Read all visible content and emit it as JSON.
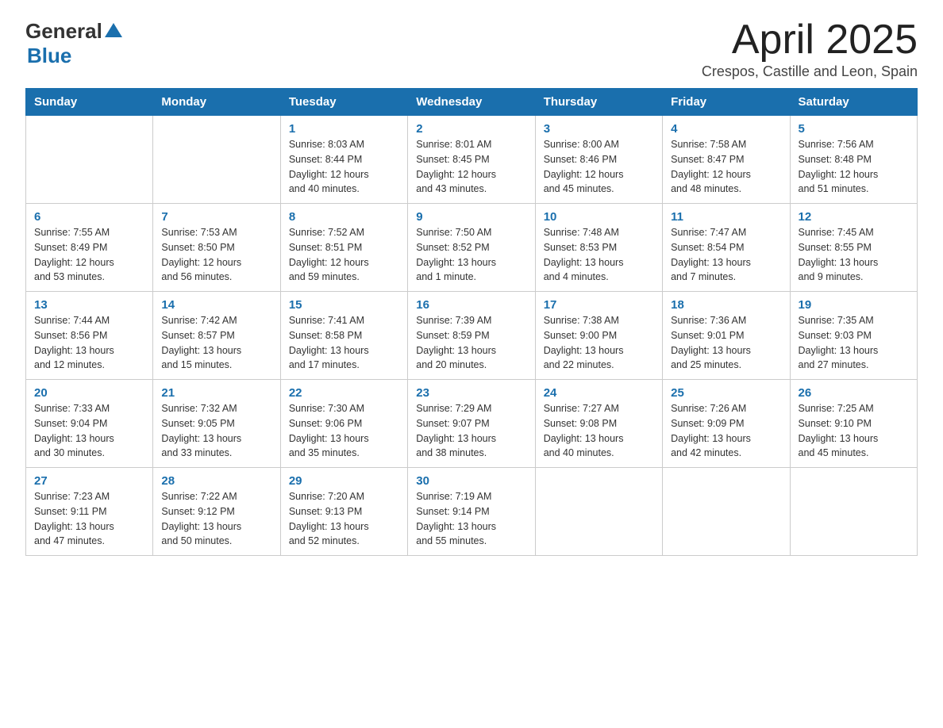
{
  "header": {
    "logo_general": "General",
    "logo_blue": "Blue",
    "title": "April 2025",
    "subtitle": "Crespos, Castille and Leon, Spain"
  },
  "calendar": {
    "days_of_week": [
      "Sunday",
      "Monday",
      "Tuesday",
      "Wednesday",
      "Thursday",
      "Friday",
      "Saturday"
    ],
    "weeks": [
      [
        {
          "day": "",
          "info": ""
        },
        {
          "day": "",
          "info": ""
        },
        {
          "day": "1",
          "info": "Sunrise: 8:03 AM\nSunset: 8:44 PM\nDaylight: 12 hours\nand 40 minutes."
        },
        {
          "day": "2",
          "info": "Sunrise: 8:01 AM\nSunset: 8:45 PM\nDaylight: 12 hours\nand 43 minutes."
        },
        {
          "day": "3",
          "info": "Sunrise: 8:00 AM\nSunset: 8:46 PM\nDaylight: 12 hours\nand 45 minutes."
        },
        {
          "day": "4",
          "info": "Sunrise: 7:58 AM\nSunset: 8:47 PM\nDaylight: 12 hours\nand 48 minutes."
        },
        {
          "day": "5",
          "info": "Sunrise: 7:56 AM\nSunset: 8:48 PM\nDaylight: 12 hours\nand 51 minutes."
        }
      ],
      [
        {
          "day": "6",
          "info": "Sunrise: 7:55 AM\nSunset: 8:49 PM\nDaylight: 12 hours\nand 53 minutes."
        },
        {
          "day": "7",
          "info": "Sunrise: 7:53 AM\nSunset: 8:50 PM\nDaylight: 12 hours\nand 56 minutes."
        },
        {
          "day": "8",
          "info": "Sunrise: 7:52 AM\nSunset: 8:51 PM\nDaylight: 12 hours\nand 59 minutes."
        },
        {
          "day": "9",
          "info": "Sunrise: 7:50 AM\nSunset: 8:52 PM\nDaylight: 13 hours\nand 1 minute."
        },
        {
          "day": "10",
          "info": "Sunrise: 7:48 AM\nSunset: 8:53 PM\nDaylight: 13 hours\nand 4 minutes."
        },
        {
          "day": "11",
          "info": "Sunrise: 7:47 AM\nSunset: 8:54 PM\nDaylight: 13 hours\nand 7 minutes."
        },
        {
          "day": "12",
          "info": "Sunrise: 7:45 AM\nSunset: 8:55 PM\nDaylight: 13 hours\nand 9 minutes."
        }
      ],
      [
        {
          "day": "13",
          "info": "Sunrise: 7:44 AM\nSunset: 8:56 PM\nDaylight: 13 hours\nand 12 minutes."
        },
        {
          "day": "14",
          "info": "Sunrise: 7:42 AM\nSunset: 8:57 PM\nDaylight: 13 hours\nand 15 minutes."
        },
        {
          "day": "15",
          "info": "Sunrise: 7:41 AM\nSunset: 8:58 PM\nDaylight: 13 hours\nand 17 minutes."
        },
        {
          "day": "16",
          "info": "Sunrise: 7:39 AM\nSunset: 8:59 PM\nDaylight: 13 hours\nand 20 minutes."
        },
        {
          "day": "17",
          "info": "Sunrise: 7:38 AM\nSunset: 9:00 PM\nDaylight: 13 hours\nand 22 minutes."
        },
        {
          "day": "18",
          "info": "Sunrise: 7:36 AM\nSunset: 9:01 PM\nDaylight: 13 hours\nand 25 minutes."
        },
        {
          "day": "19",
          "info": "Sunrise: 7:35 AM\nSunset: 9:03 PM\nDaylight: 13 hours\nand 27 minutes."
        }
      ],
      [
        {
          "day": "20",
          "info": "Sunrise: 7:33 AM\nSunset: 9:04 PM\nDaylight: 13 hours\nand 30 minutes."
        },
        {
          "day": "21",
          "info": "Sunrise: 7:32 AM\nSunset: 9:05 PM\nDaylight: 13 hours\nand 33 minutes."
        },
        {
          "day": "22",
          "info": "Sunrise: 7:30 AM\nSunset: 9:06 PM\nDaylight: 13 hours\nand 35 minutes."
        },
        {
          "day": "23",
          "info": "Sunrise: 7:29 AM\nSunset: 9:07 PM\nDaylight: 13 hours\nand 38 minutes."
        },
        {
          "day": "24",
          "info": "Sunrise: 7:27 AM\nSunset: 9:08 PM\nDaylight: 13 hours\nand 40 minutes."
        },
        {
          "day": "25",
          "info": "Sunrise: 7:26 AM\nSunset: 9:09 PM\nDaylight: 13 hours\nand 42 minutes."
        },
        {
          "day": "26",
          "info": "Sunrise: 7:25 AM\nSunset: 9:10 PM\nDaylight: 13 hours\nand 45 minutes."
        }
      ],
      [
        {
          "day": "27",
          "info": "Sunrise: 7:23 AM\nSunset: 9:11 PM\nDaylight: 13 hours\nand 47 minutes."
        },
        {
          "day": "28",
          "info": "Sunrise: 7:22 AM\nSunset: 9:12 PM\nDaylight: 13 hours\nand 50 minutes."
        },
        {
          "day": "29",
          "info": "Sunrise: 7:20 AM\nSunset: 9:13 PM\nDaylight: 13 hours\nand 52 minutes."
        },
        {
          "day": "30",
          "info": "Sunrise: 7:19 AM\nSunset: 9:14 PM\nDaylight: 13 hours\nand 55 minutes."
        },
        {
          "day": "",
          "info": ""
        },
        {
          "day": "",
          "info": ""
        },
        {
          "day": "",
          "info": ""
        }
      ]
    ]
  }
}
